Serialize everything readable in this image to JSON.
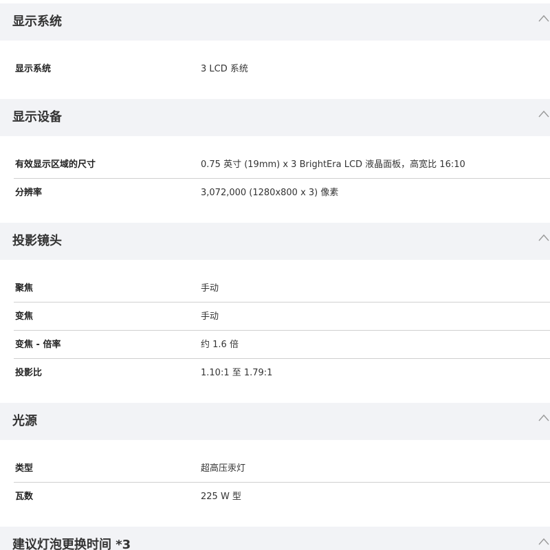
{
  "sections": [
    {
      "title": "显示系统",
      "rows": [
        {
          "label": "显示系统",
          "value": "3 LCD 系统"
        }
      ]
    },
    {
      "title": "显示设备",
      "rows": [
        {
          "label": "有效显示区域的尺寸",
          "value": "0.75 英寸 (19mm) x 3 BrightEra LCD 液晶面板，高宽比 16:10"
        },
        {
          "label": "分辨率",
          "value": "3,072,000 (1280x800 x 3) 像素"
        }
      ]
    },
    {
      "title": "投影镜头",
      "rows": [
        {
          "label": "聚焦",
          "value": "手动"
        },
        {
          "label": "变焦",
          "value": "手动"
        },
        {
          "label": "变焦 - 倍率",
          "value": "约 1.6 倍"
        },
        {
          "label": "投影比",
          "value": "1.10:1 至 1.79:1"
        }
      ]
    },
    {
      "title": "光源",
      "rows": [
        {
          "label": "类型",
          "value": "超高压汞灯"
        },
        {
          "label": "瓦数",
          "value": "225 W 型"
        }
      ]
    },
    {
      "title": "建议灯泡更换时间 *3",
      "rows": []
    }
  ],
  "icons": {
    "collapse": "chevron-up-icon"
  }
}
